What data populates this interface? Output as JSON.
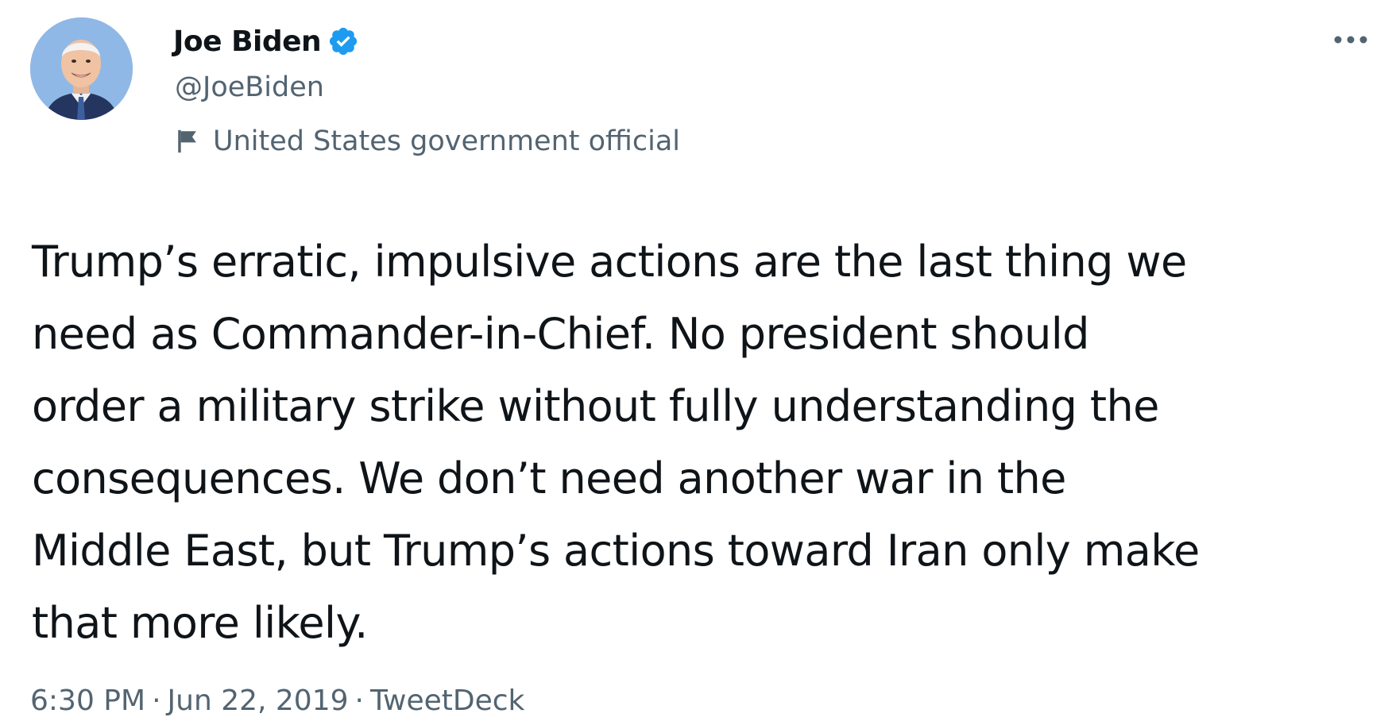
{
  "author": {
    "display_name": "Joe Biden",
    "handle": "@JoeBiden",
    "label": "United States government official",
    "verified": true
  },
  "tweet": {
    "text": "Trump’s erratic, impulsive actions are the last thing we\nneed as Commander-in-Chief. No president should\norder a military strike without fully understanding the\nconsequences. We don’t need another war in the\nMiddle East, but Trump’s actions toward Iran only make\nthat more likely."
  },
  "meta": {
    "time": "6:30 PM",
    "date": "Jun 22, 2019",
    "source": "TweetDeck",
    "separator": "·"
  },
  "colors": {
    "verified_blue": "#1d9bf0",
    "secondary_text": "#536471",
    "primary_text": "#0f1419"
  },
  "icons": {
    "verified": "verified-badge-icon",
    "label": "flag-icon",
    "more": "more-options-icon"
  }
}
